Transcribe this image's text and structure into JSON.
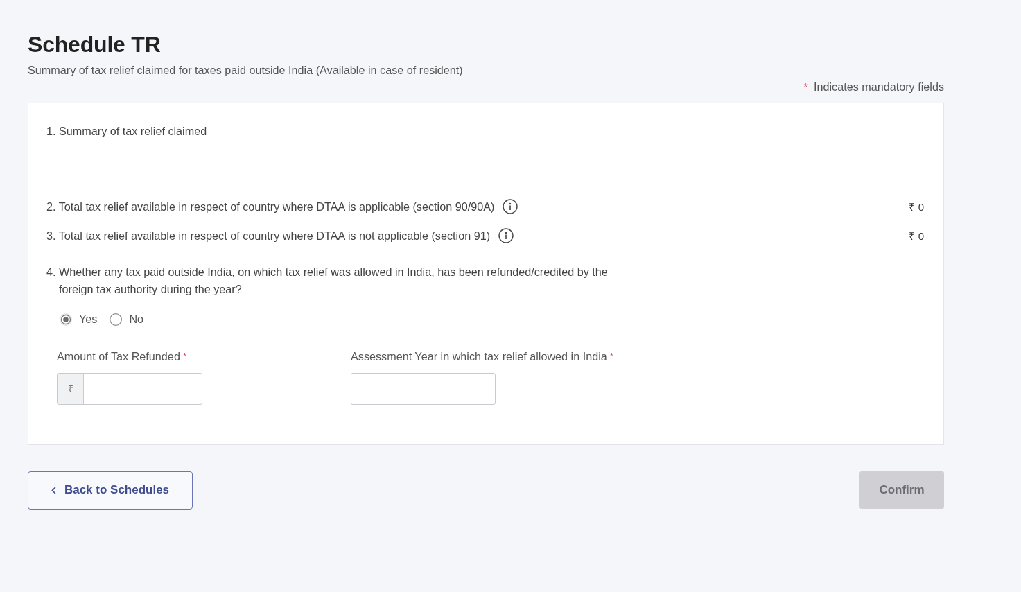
{
  "header": {
    "title": "Schedule TR",
    "subtitle": "Summary of tax relief claimed for taxes paid outside India (Available in case of resident)",
    "mandatory_note": {
      "mark": "*",
      "text": "Indicates mandatory fields"
    }
  },
  "form": {
    "items": [
      {
        "kind": "heading",
        "label": "1. Summary of tax relief claimed"
      },
      {
        "kind": "amount",
        "label": "2. Total tax relief available in respect of country where DTAA is applicable (section 90/90A)",
        "info": true,
        "value": "₹ 0"
      },
      {
        "kind": "amount",
        "label": "3. Total tax relief available in respect of country where DTAA is not applicable (section 91)",
        "info": true,
        "value": "₹ 0"
      },
      {
        "kind": "question",
        "label": "4. Whether any tax paid outside India, on which tax relief was allowed in India, has been refunded/credited by the foreign tax authority during the year?",
        "options": [
          {
            "label": "Yes",
            "selected": true
          },
          {
            "label": "No",
            "selected": false
          }
        ]
      }
    ],
    "fields": [
      {
        "label": "Amount of Tax Refunded",
        "required_mark": "*",
        "prefix": "₹"
      },
      {
        "label": "Assessment Year in which tax relief allowed in India",
        "required_mark": "*"
      }
    ]
  },
  "buttons": [
    {
      "kind": "back",
      "label": "Back to Schedules",
      "disabled": false
    },
    {
      "kind": "primary",
      "label": "Confirm",
      "disabled": true
    }
  ]
}
